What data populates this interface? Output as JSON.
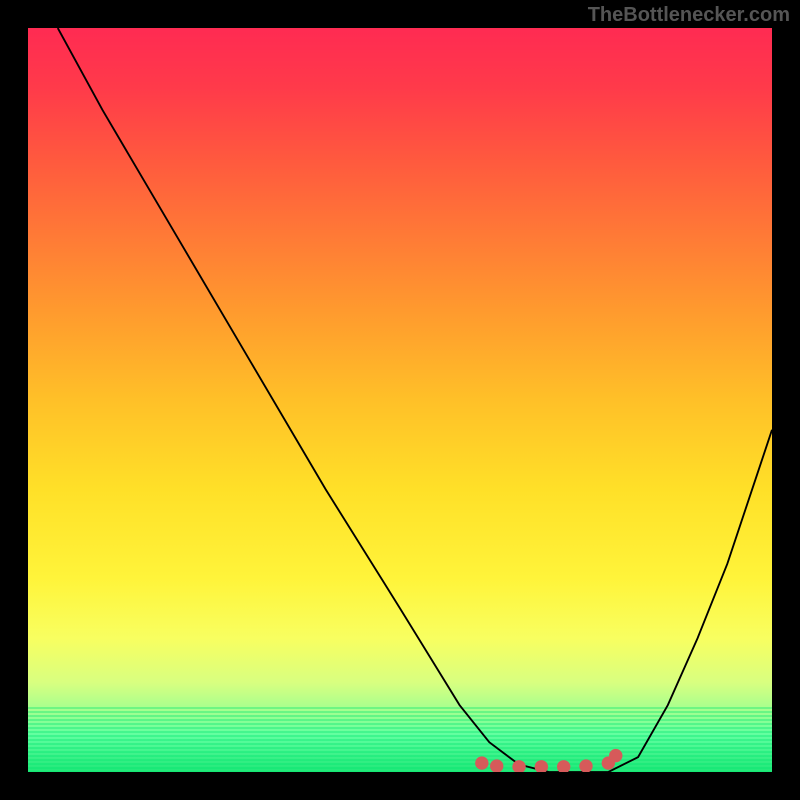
{
  "watermark": "TheBottleneсker.com",
  "chart_data": {
    "type": "line",
    "title": "",
    "xlabel": "",
    "ylabel": "",
    "xlim": [
      0,
      100
    ],
    "ylim": [
      0,
      100
    ],
    "x": [
      4,
      10,
      20,
      30,
      40,
      50,
      58,
      62,
      66,
      70,
      74,
      78,
      82,
      86,
      90,
      94,
      98,
      100
    ],
    "y": [
      100,
      89,
      72,
      55,
      38,
      22,
      9,
      4,
      1,
      0,
      0,
      0,
      2,
      9,
      18,
      28,
      40,
      46
    ],
    "marker_points": {
      "x": [
        61,
        63,
        66,
        69,
        72,
        75,
        78,
        79
      ],
      "y": [
        1.2,
        0.8,
        0.7,
        0.7,
        0.7,
        0.8,
        1.2,
        2.2
      ]
    },
    "colors": {
      "line": "#000000",
      "markers": "#d65a5a"
    }
  }
}
